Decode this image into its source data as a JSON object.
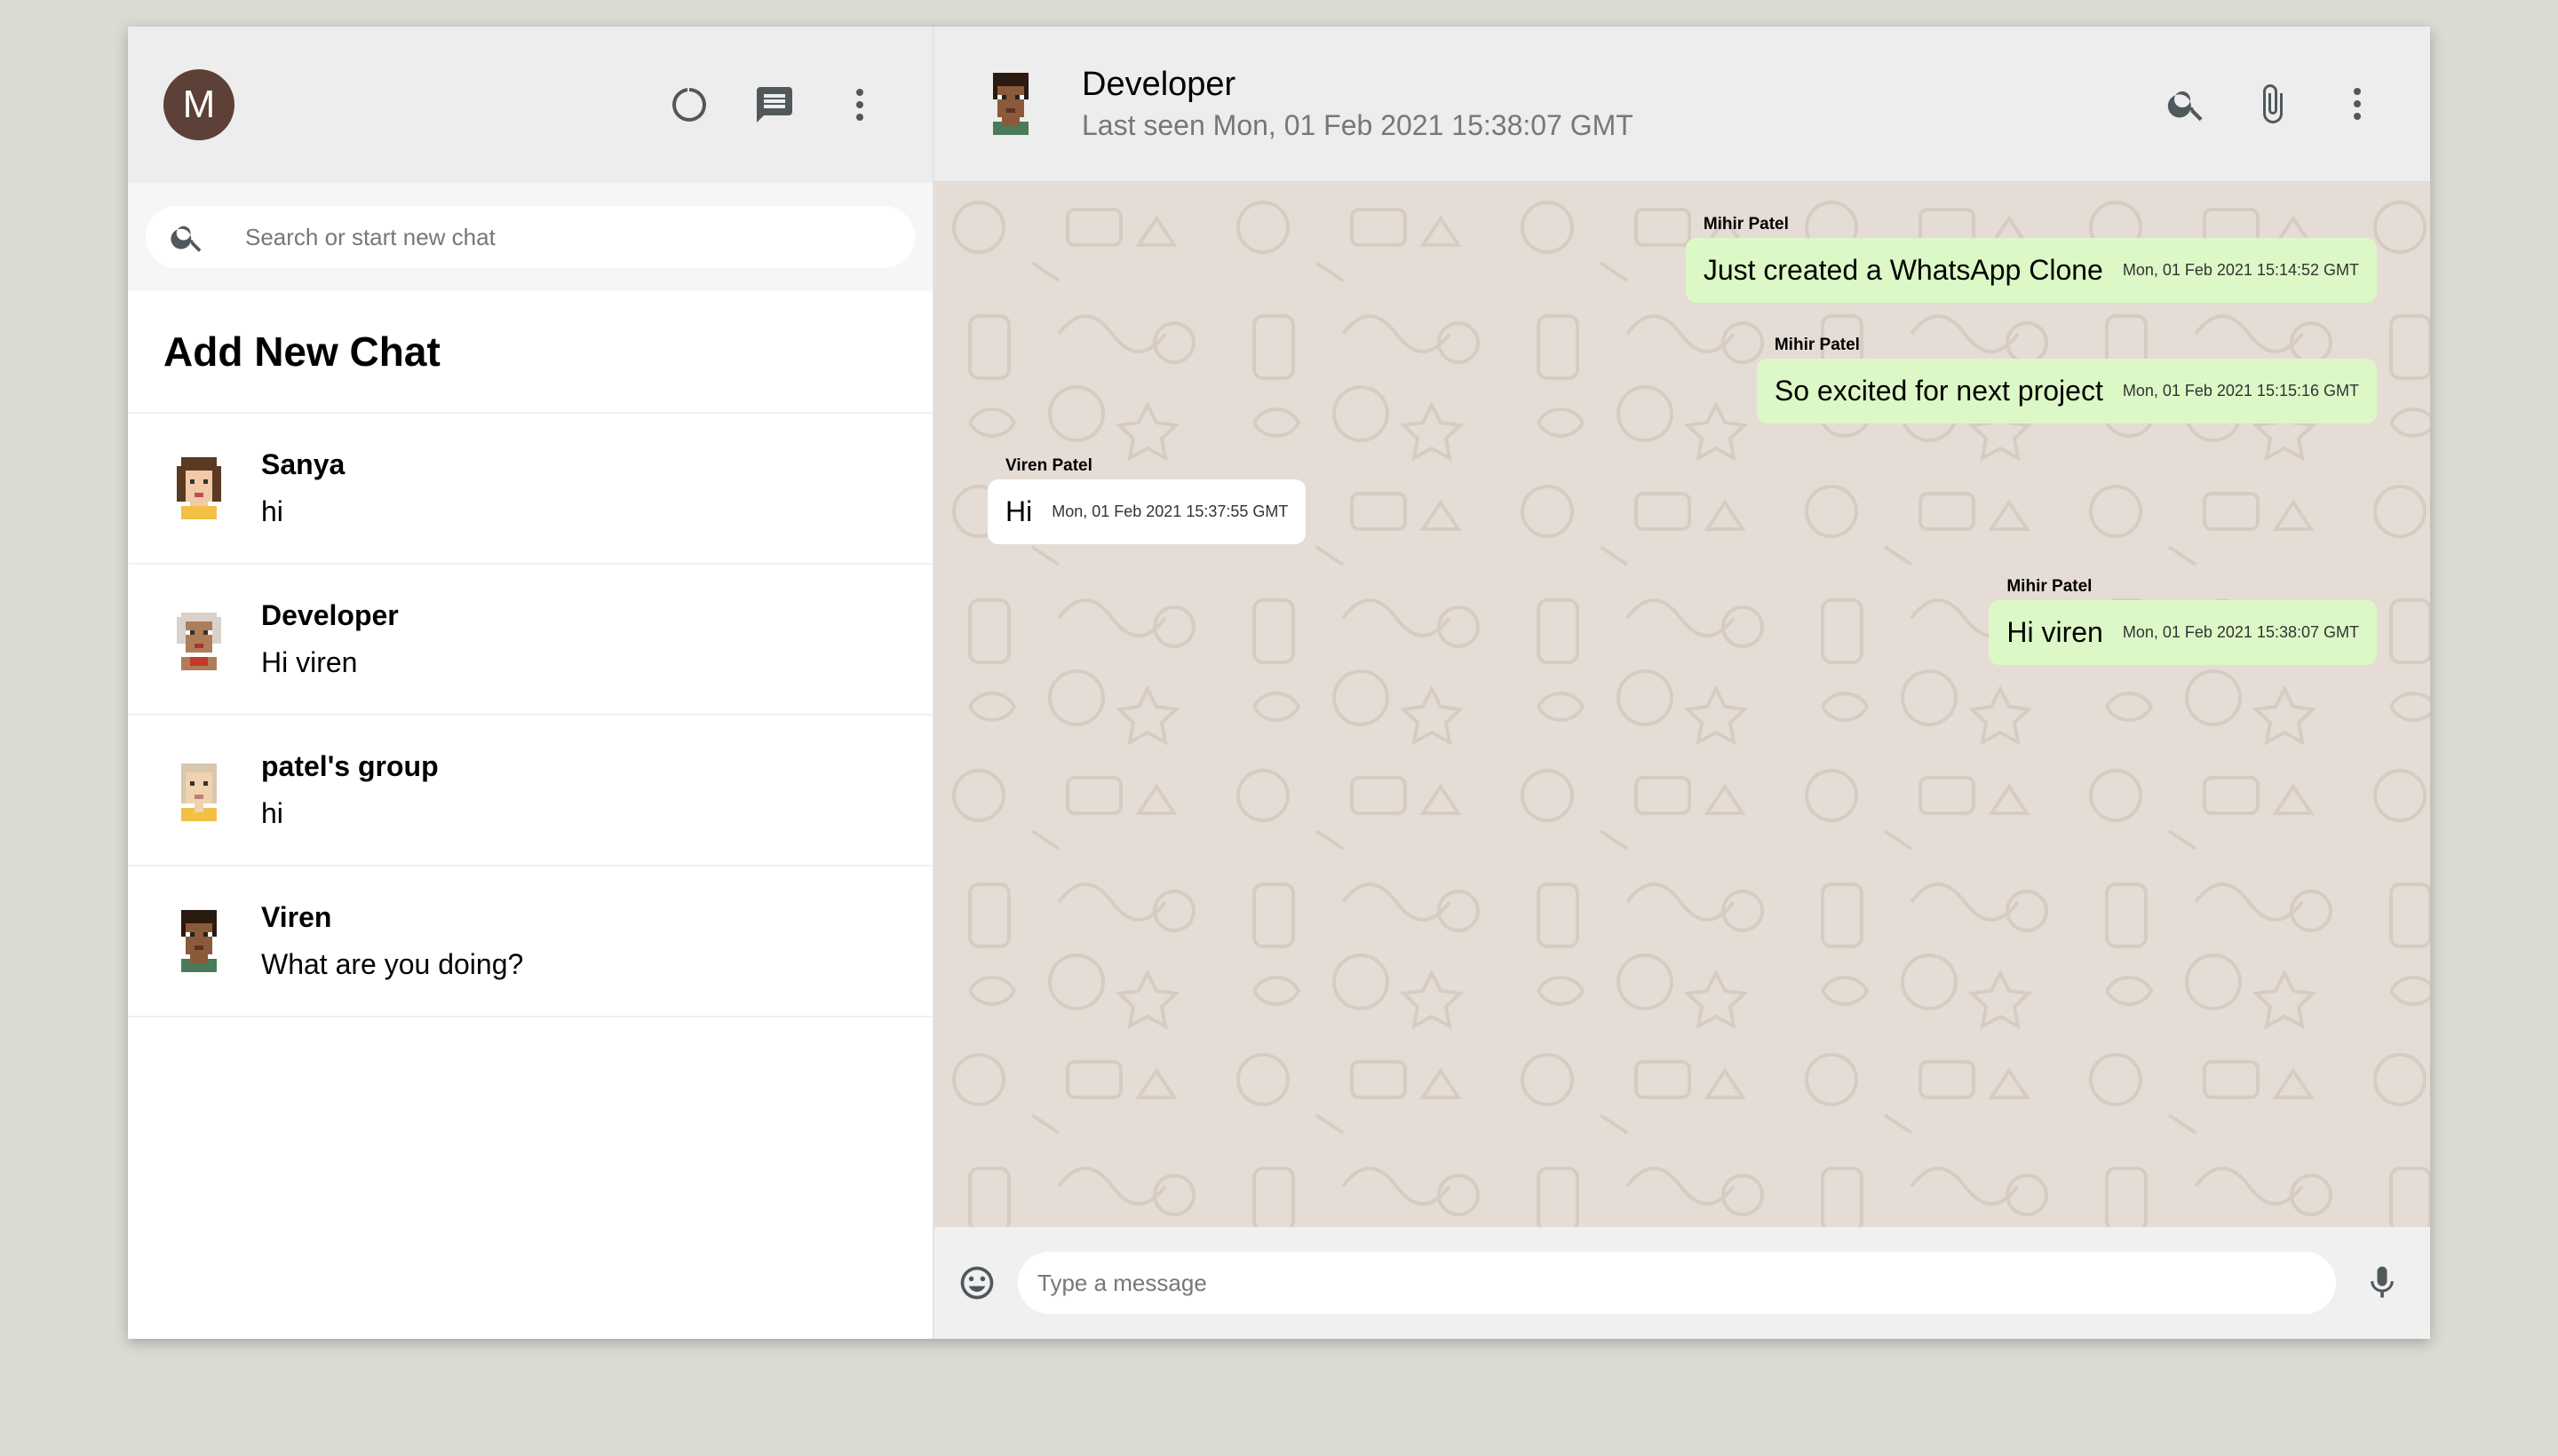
{
  "user": {
    "avatar_letter": "M"
  },
  "sidebar": {
    "search_placeholder": "Search or start new chat",
    "add_new_chat": "Add New Chat",
    "chats": [
      {
        "name": "Sanya",
        "last_message": "hi",
        "avatar": "sanya-avatar"
      },
      {
        "name": "Developer",
        "last_message": "Hi viren",
        "avatar": "developer-avatar"
      },
      {
        "name": "patel's group",
        "last_message": "hi",
        "avatar": "group-avatar"
      },
      {
        "name": "Viren",
        "last_message": "What are you doing?",
        "avatar": "viren-avatar"
      }
    ]
  },
  "chat": {
    "name": "Developer",
    "last_seen": "Last seen Mon, 01 Feb 2021 15:38:07 GMT",
    "messages": [
      {
        "sender": "Mihir Patel",
        "text": "Just created a WhatsApp Clone",
        "time": "Mon, 01 Feb 2021 15:14:52 GMT",
        "type": "sent"
      },
      {
        "sender": "Mihir Patel",
        "text": "So excited for next project",
        "time": "Mon, 01 Feb 2021 15:15:16 GMT",
        "type": "sent"
      },
      {
        "sender": "Viren Patel",
        "text": "Hi",
        "time": "Mon, 01 Feb 2021 15:37:55 GMT",
        "type": "received"
      },
      {
        "sender": "Mihir Patel",
        "text": "Hi viren",
        "time": "Mon, 01 Feb 2021 15:38:07 GMT",
        "type": "sent"
      }
    ],
    "input_placeholder": "Type a message"
  },
  "colors": {
    "sent_bubble": "#dcf8c6",
    "received_bubble": "#ffffff",
    "header_bg": "#ededed",
    "chat_bg": "#e5ddd5",
    "avatar_bg": "#5d4037"
  },
  "icons": [
    "status-icon",
    "new-chat-icon",
    "menu-icon",
    "search-icon",
    "attach-icon",
    "emoji-icon",
    "mic-icon"
  ]
}
